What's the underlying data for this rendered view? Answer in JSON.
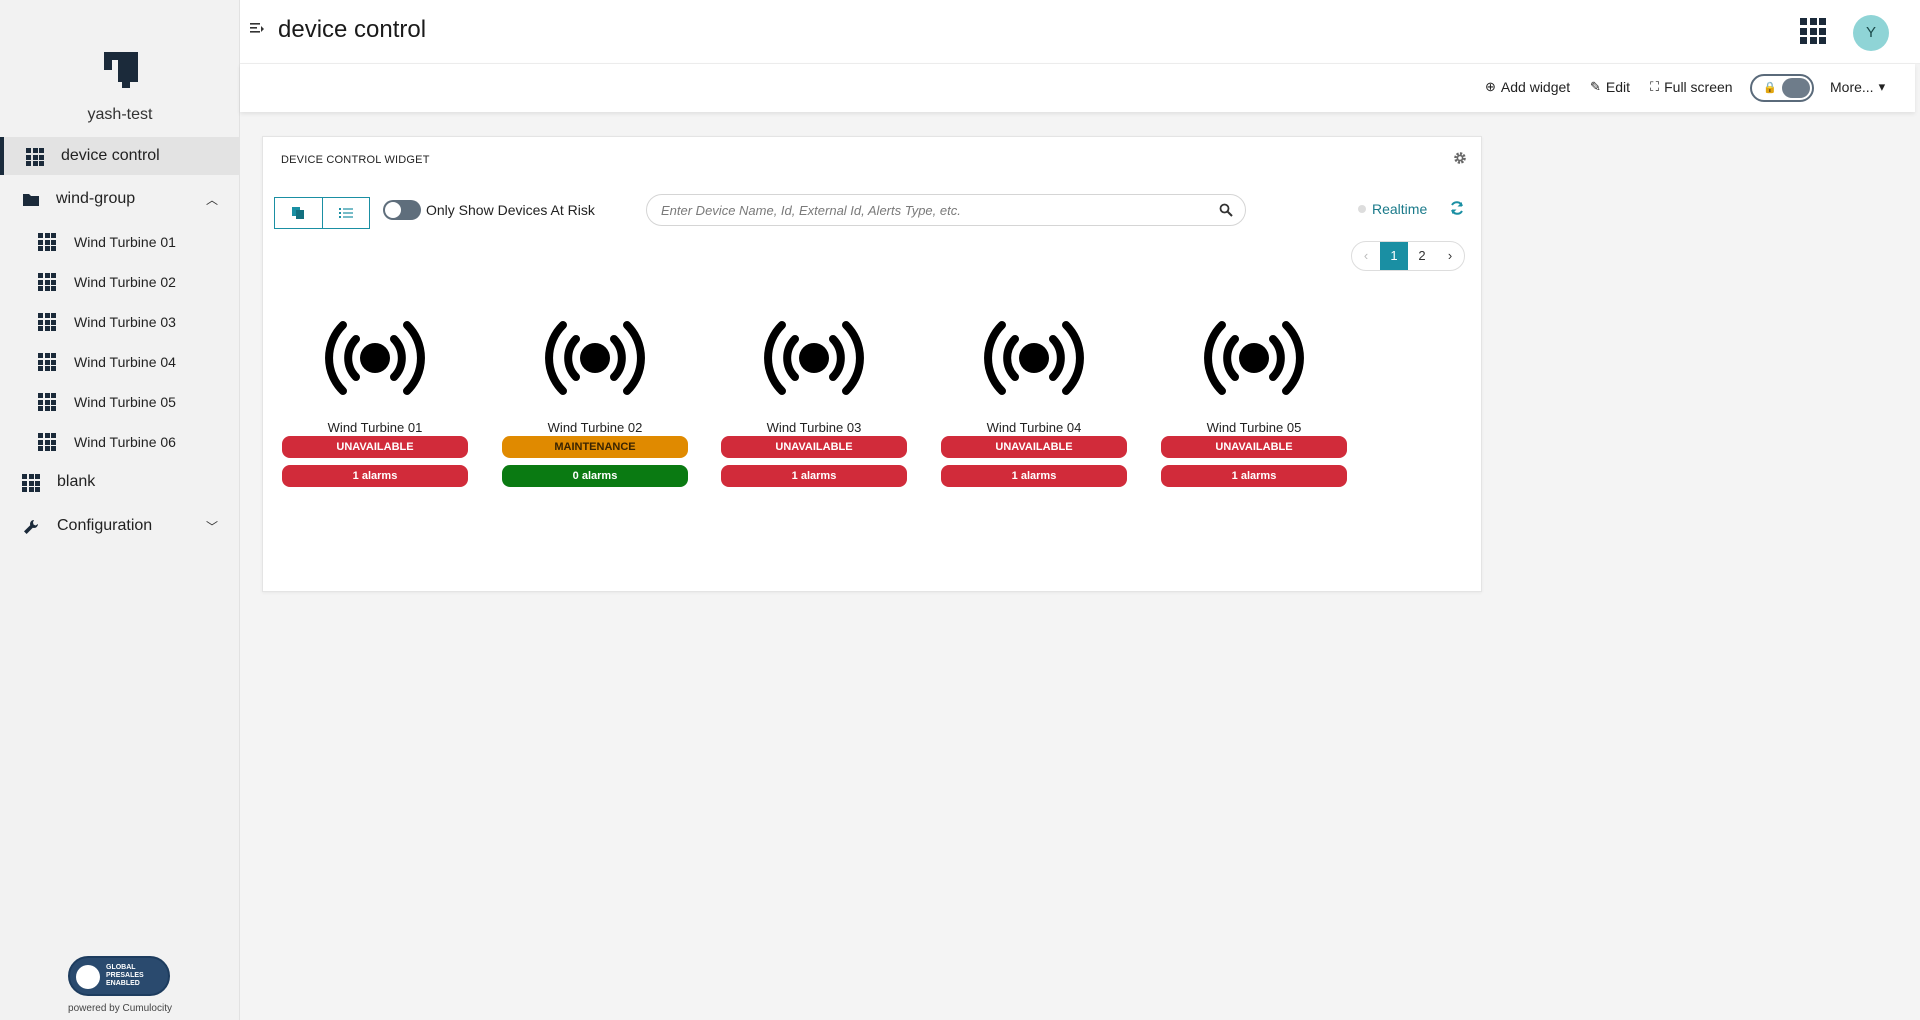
{
  "sidebar": {
    "tenant": "yash-test",
    "items": [
      {
        "label": "device control"
      },
      {
        "label": "wind-group"
      },
      {
        "label": "blank"
      },
      {
        "label": "Configuration"
      }
    ],
    "subitems": [
      {
        "label": "Wind Turbine 01"
      },
      {
        "label": "Wind Turbine 02"
      },
      {
        "label": "Wind Turbine 03"
      },
      {
        "label": "Wind Turbine 04"
      },
      {
        "label": "Wind Turbine 05"
      },
      {
        "label": "Wind Turbine 06"
      }
    ],
    "badge_text": "GLOBAL PRESALES ENABLED",
    "powered_by": "powered by Cumulocity"
  },
  "header": {
    "title": "device control",
    "avatar_initial": "Y"
  },
  "actionbar": {
    "add_widget": "Add widget",
    "edit": "Edit",
    "full_screen": "Full screen",
    "more": "More..."
  },
  "widget": {
    "title": "DEVICE CONTROL WIDGET",
    "risk_toggle_label": "Only Show Devices At Risk",
    "search_placeholder": "Enter Device Name, Id, External Id, Alerts Type, etc.",
    "realtime": "Realtime",
    "pages": [
      "1",
      "2"
    ],
    "prev": "‹",
    "next": "›",
    "devices": [
      {
        "name": "Wind Turbine 01",
        "status": "UNAVAILABLE",
        "alarms": "1 alarms"
      },
      {
        "name": "Wind Turbine 02",
        "status": "MAINTENANCE",
        "alarms": "0 alarms"
      },
      {
        "name": "Wind Turbine 03",
        "status": "UNAVAILABLE",
        "alarms": "1 alarms"
      },
      {
        "name": "Wind Turbine 04",
        "status": "UNAVAILABLE",
        "alarms": "1 alarms"
      },
      {
        "name": "Wind Turbine 05",
        "status": "UNAVAILABLE",
        "alarms": "1 alarms"
      }
    ]
  },
  "colors": {
    "unavailable": "#d12b3a",
    "maintenance": "#e08a00",
    "ok": "#0a7a12",
    "accent": "#1a8fa3"
  }
}
